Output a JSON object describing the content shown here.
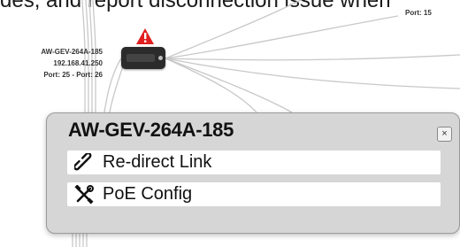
{
  "caption": "des, and report disconnection issue when",
  "topology": {
    "top_port_label": "Port: 15",
    "device": {
      "name": "AW-GEV-264A-185",
      "ip": "192.168.41.250",
      "ports": "Port: 25 - Port: 26",
      "alert_color": "#e02020",
      "alert_icon": "warning-triangle-icon"
    }
  },
  "popup": {
    "title": "AW-GEV-264A-185",
    "close_glyph": "×",
    "items": [
      {
        "label": "Re-direct Link",
        "icon": "link-icon"
      },
      {
        "label": "PoE Config",
        "icon": "tools-icon"
      }
    ]
  }
}
